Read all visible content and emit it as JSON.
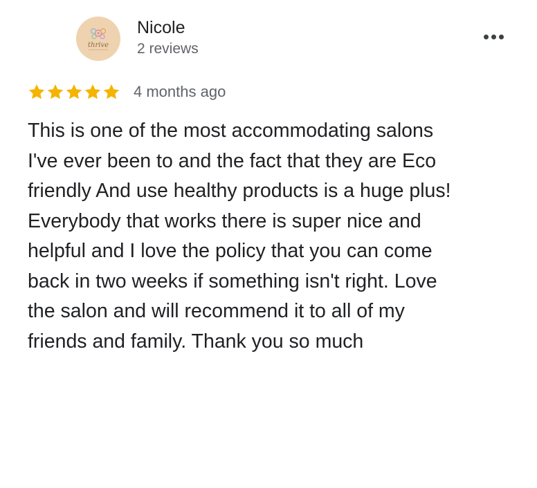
{
  "review": {
    "author": {
      "name": "Nicole",
      "review_count": "2 reviews",
      "avatar_text": "thrive"
    },
    "rating": 5,
    "rating_max": 5,
    "date": "4 months ago",
    "text": "This is one of the most accommodating salons\nI've ever been to and the fact that they are Eco\nfriendly And use healthy products is a huge plus!\nEverybody that works there is super nice and\nhelpful and I love the policy that you can come\nback in two weeks if something isn't right. Love\nthe salon and will recommend it to all of my\nfriends and family. Thank you so much"
  },
  "icons": {
    "more": "more-vert-icon",
    "star": "star-icon"
  },
  "colors": {
    "star": "#f4b400",
    "primary_text": "#202124",
    "secondary_text": "#5f6368",
    "avatar_bg": "#efd3b0"
  }
}
